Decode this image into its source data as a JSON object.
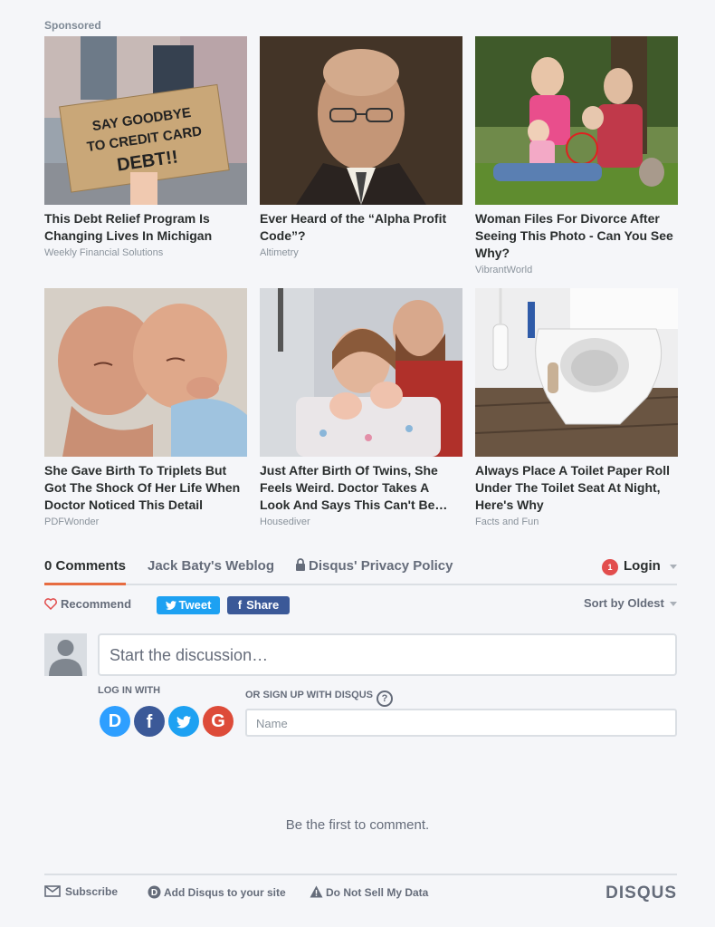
{
  "sponsored_label": "Sponsored",
  "ads": [
    {
      "title": "This Debt Relief Program Is Changing Lives In Michigan",
      "source": "Weekly Financial Solutions",
      "sign_text_1": "SAY GOODBYE",
      "sign_text_2": "TO CREDIT CARD",
      "sign_text_3": "DEBT!!"
    },
    {
      "title": "Ever Heard of the “Alpha Profit Code”?",
      "source": "Altimetry"
    },
    {
      "title": "Woman Files For Divorce After Seeing This Photo - Can You See Why?",
      "source": "VibrantWorld"
    },
    {
      "title": "She Gave Birth To Triplets But Got The Shock Of Her Life When Doctor Noticed This Detail",
      "source": "PDFWonder"
    },
    {
      "title": "Just After Birth Of Twins, She Feels Weird. Doctor Takes A Look And Says This Can't Be…",
      "source": "Housediver"
    },
    {
      "title": "Always Place A Toilet Paper Roll Under The Toilet Seat At Night, Here's Why",
      "source": "Facts and Fun"
    }
  ],
  "tabs": {
    "comments": "0 Comments",
    "site": "Jack Baty's Weblog",
    "privacy": "Disqus' Privacy Policy",
    "login_badge": "1",
    "login": "Login"
  },
  "actions": {
    "recommend": "Recommend",
    "tweet": "Tweet",
    "share": "Share",
    "sort": "Sort by Oldest"
  },
  "composer": {
    "placeholder": "Start the discussion…",
    "login_with": "LOG IN WITH",
    "signup": "OR SIGN UP WITH DISQUS",
    "help": "?",
    "name_placeholder": "Name",
    "social": [
      "D",
      "f",
      "t",
      "G"
    ]
  },
  "empty_message": "Be the first to comment.",
  "footer": {
    "subscribe": "Subscribe",
    "add_disqus": "Add Disqus to your site",
    "do_not_sell": "Do Not Sell My Data",
    "logo": "DISQUS"
  },
  "colors": {
    "accent": "#e76c41",
    "twitter": "#1da1f2",
    "facebook": "#3b5998",
    "google": "#dd4b39",
    "disqus": "#2e9fff",
    "badge": "#e24d4d"
  }
}
